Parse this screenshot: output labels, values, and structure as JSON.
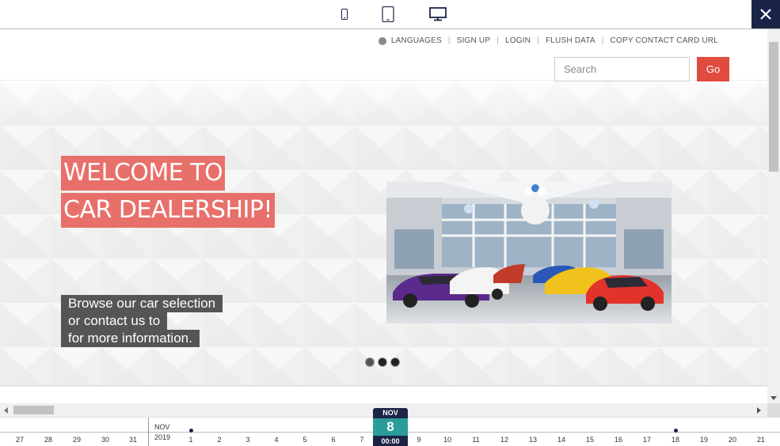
{
  "device_bar": {
    "icons": [
      "mobile-icon",
      "tablet-icon",
      "desktop-icon"
    ],
    "active_device": "desktop",
    "close_icon": "close-icon"
  },
  "header": {
    "links": {
      "languages": "LANGUAGES",
      "sign_up": "SIGN UP",
      "login": "LOGIN",
      "flush_data": "FLUSH DATA",
      "copy_contact_card": "COPY CONTACT CARD URL"
    },
    "search_placeholder": "Search",
    "go_label": "Go"
  },
  "hero": {
    "welcome_line1": "WELCOME TO",
    "welcome_line2": "CAR DEALERSHIP!",
    "browse_line1": "Browse our car selection",
    "browse_line2": "or contact us to",
    "browse_line3": "for more information.",
    "carousel_dots": 3,
    "active_dot": 0
  },
  "timeline": {
    "month_label": "NOV",
    "year_label": "2019",
    "current_month": "NOV",
    "current_day": "8",
    "current_time": "00:00",
    "prev_days": [
      "27",
      "28",
      "29",
      "30",
      "31"
    ],
    "days_before": [
      "1",
      "2",
      "3",
      "4",
      "5",
      "6",
      "7"
    ],
    "days_after": [
      "9",
      "10",
      "11",
      "12",
      "13",
      "14",
      "15",
      "16",
      "17",
      "18",
      "19",
      "20",
      "21"
    ]
  },
  "colors": {
    "accent_red": "#e04b3f",
    "welcome_bg": "#e8706a",
    "navy": "#1b2447",
    "teal": "#2a9d9b"
  }
}
